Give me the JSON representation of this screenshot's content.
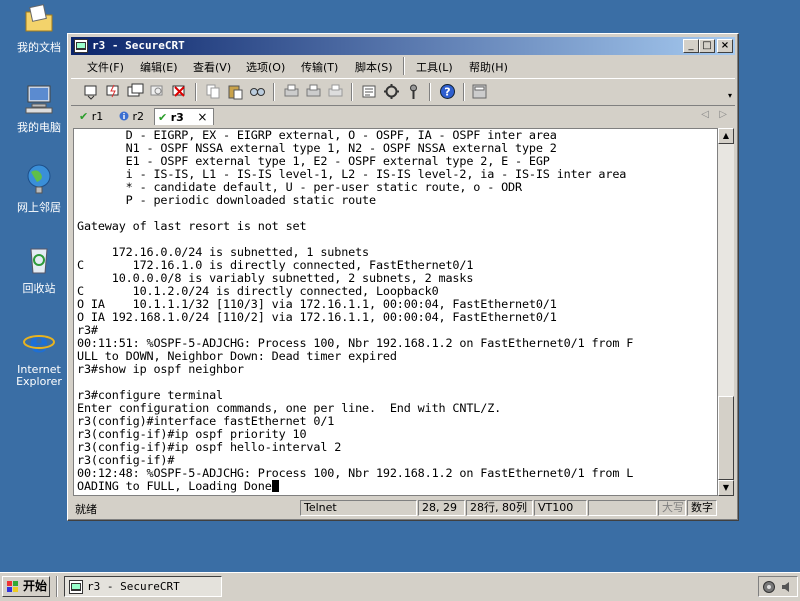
{
  "desktop": {
    "icons": [
      {
        "label": "我的文档",
        "icon": "folder-documents-icon"
      },
      {
        "label": "我的电脑",
        "icon": "computer-icon"
      },
      {
        "label": "网上邻居",
        "icon": "network-icon"
      },
      {
        "label": "回收站",
        "icon": "recycle-bin-icon"
      },
      {
        "label": "Internet Explorer",
        "icon": "ie-icon"
      }
    ]
  },
  "window": {
    "title": "r3 - SecureCRT",
    "menu": [
      "文件(F)",
      "编辑(E)",
      "查看(V)",
      "选项(O)",
      "传输(T)",
      "脚本(S)",
      "工具(L)",
      "帮助(H)"
    ],
    "tabs": [
      {
        "label": "r1",
        "status": "connected"
      },
      {
        "label": "r2",
        "status": "info"
      },
      {
        "label": "r3",
        "status": "connected",
        "active": true
      }
    ],
    "tab_close": "×"
  },
  "terminal": {
    "lines": [
      "       D - EIGRP, EX - EIGRP external, O - OSPF, IA - OSPF inter area",
      "       N1 - OSPF NSSA external type 1, N2 - OSPF NSSA external type 2",
      "       E1 - OSPF external type 1, E2 - OSPF external type 2, E - EGP",
      "       i - IS-IS, L1 - IS-IS level-1, L2 - IS-IS level-2, ia - IS-IS inter area",
      "       * - candidate default, U - per-user static route, o - ODR",
      "       P - periodic downloaded static route",
      "",
      "Gateway of last resort is not set",
      "",
      "     172.16.0.0/24 is subnetted, 1 subnets",
      "C       172.16.1.0 is directly connected, FastEthernet0/1",
      "     10.0.0.0/8 is variably subnetted, 2 subnets, 2 masks",
      "C       10.1.2.0/24 is directly connected, Loopback0",
      "O IA    10.1.1.1/32 [110/3] via 172.16.1.1, 00:00:04, FastEthernet0/1",
      "O IA 192.168.1.0/24 [110/2] via 172.16.1.1, 00:00:04, FastEthernet0/1",
      "r3#",
      "00:11:51: %OSPF-5-ADJCHG: Process 100, Nbr 192.168.1.2 on FastEthernet0/1 from F",
      "ULL to DOWN, Neighbor Down: Dead timer expired",
      "r3#show ip ospf neighbor",
      "",
      "r3#configure terminal",
      "Enter configuration commands, one per line.  End with CNTL/Z.",
      "r3(config)#interface fastEthernet 0/1",
      "r3(config-if)#ip ospf priority 10",
      "r3(config-if)#ip ospf hello-interval 2",
      "r3(config-if)#",
      "00:12:48: %OSPF-5-ADJCHG: Process 100, Nbr 192.168.1.2 on FastEthernet0/1 from L",
      "OADING to FULL, Loading Done"
    ]
  },
  "statusbar": {
    "ready": "就绪",
    "protocol": "Telnet",
    "cursor_pos": "28, 29",
    "rows_cols": "28行, 80列",
    "terminal_type": "VT100",
    "caps": "大写",
    "num": "数字"
  },
  "taskbar": {
    "start_label": "开始",
    "task_label": "r3 - SecureCRT"
  }
}
